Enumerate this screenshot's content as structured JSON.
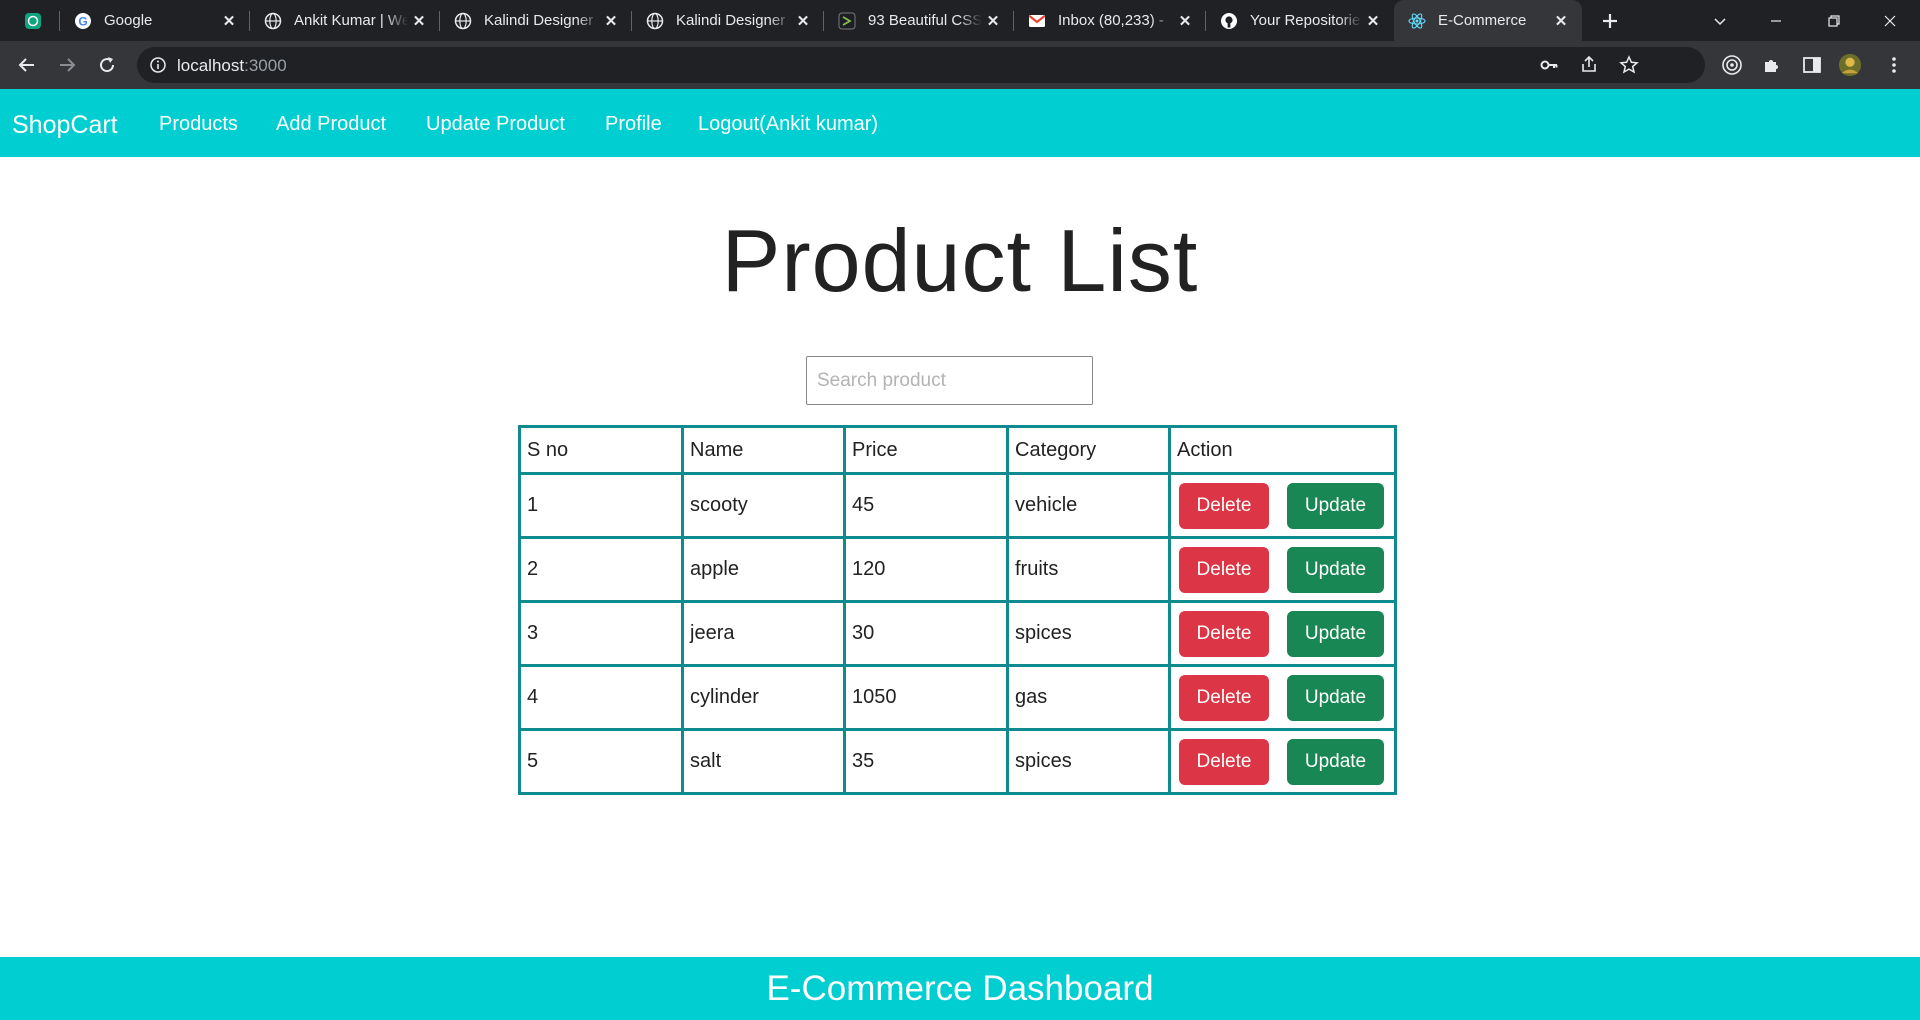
{
  "browser": {
    "tabs": [
      {
        "title": "",
        "favicon": "chatgpt-icon"
      },
      {
        "title": "Google",
        "favicon": "google-icon"
      },
      {
        "title": "Ankit Kumar | Web Developer",
        "favicon": "globe-icon"
      },
      {
        "title": "Kalindi Designer",
        "favicon": "globe-icon"
      },
      {
        "title": "Kalindi Designer",
        "favicon": "globe-icon"
      },
      {
        "title": "93 Beautiful CSS",
        "favicon": "codepen-icon"
      },
      {
        "title": "Inbox (80,233) -",
        "favicon": "gmail-icon"
      },
      {
        "title": "Your Repositories",
        "favicon": "github-icon"
      },
      {
        "title": "E-Commerce",
        "favicon": "react-icon",
        "active": true
      }
    ],
    "url_host": "localhost",
    "url_port": ":3000"
  },
  "navbar": {
    "brand": "ShopCart",
    "links": {
      "products": "Products",
      "add_product": "Add Product",
      "update_product": "Update Product",
      "profile": "Profile",
      "logout": "Logout(Ankit kumar)"
    }
  },
  "main": {
    "title": "Product List",
    "search_placeholder": "Search product",
    "table": {
      "headers": [
        "S no",
        "Name",
        "Price",
        "Category",
        "Action"
      ],
      "rows": [
        {
          "sno": "1",
          "name": "scooty",
          "price": "45",
          "category": "vehicle"
        },
        {
          "sno": "2",
          "name": "apple",
          "price": "120",
          "category": "fruits"
        },
        {
          "sno": "3",
          "name": "jeera",
          "price": "30",
          "category": "spices"
        },
        {
          "sno": "4",
          "name": "cylinder",
          "price": "1050",
          "category": "gas"
        },
        {
          "sno": "5",
          "name": "salt",
          "price": "35",
          "category": "spices"
        }
      ],
      "delete_label": "Delete",
      "update_label": "Update"
    }
  },
  "footer": {
    "text": "E-Commerce Dashboard"
  },
  "colors": {
    "accent": "#00ced1",
    "table_border": "#0f8a8e",
    "delete": "#dc3545",
    "update": "#198754"
  }
}
